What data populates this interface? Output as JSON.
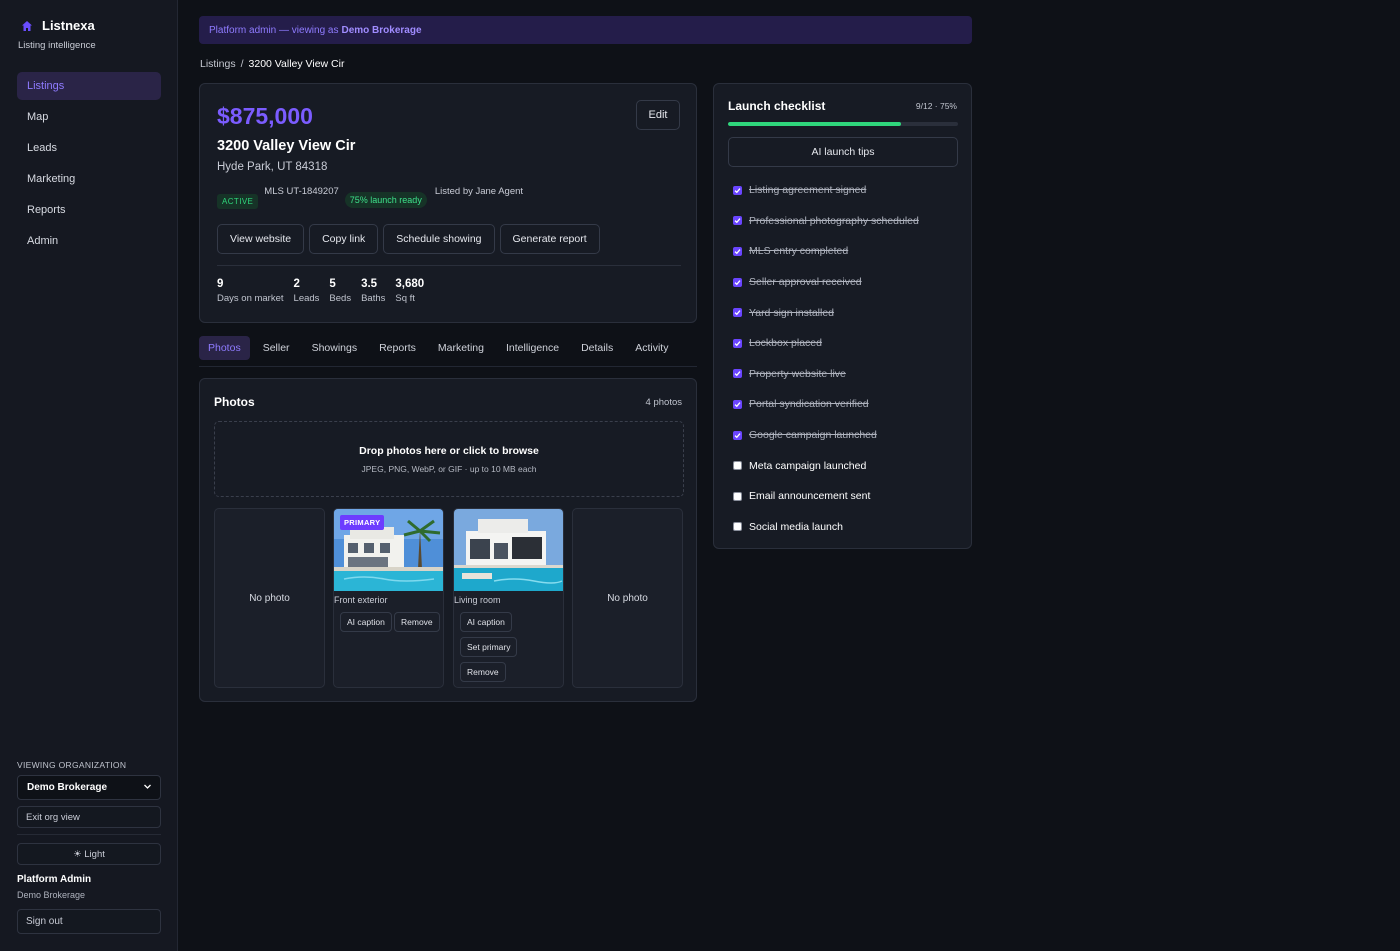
{
  "app": {
    "name": "Listnexa",
    "tagline": "Listing intelligence",
    "nav": [
      "Listings",
      "Map",
      "Leads",
      "Marketing",
      "Reports",
      "Admin"
    ],
    "active_nav": "Listings"
  },
  "sidebar_footer": {
    "org_label": "VIEWING ORGANIZATION",
    "org_selected": "Demo Brokerage",
    "exit_label": "Exit org view",
    "theme_icon": "sun-icon",
    "theme_label": "☀ Light",
    "user_name": "Platform Admin",
    "user_org": "Demo Brokerage",
    "signout_label": "Sign out"
  },
  "banner": {
    "text": "Platform admin — viewing as",
    "org": "Demo Brokerage"
  },
  "breadcrumb": {
    "root": "Listings",
    "separator": "/",
    "current": "3200 Valley View Cir"
  },
  "listing": {
    "price": "$875,000",
    "edit_label": "Edit",
    "address": "3200 Valley View Cir",
    "city_line": "Hyde Park, UT 84318",
    "status": "ACTIVE",
    "mls": "MLS UT-1849207",
    "readiness": "75% launch ready",
    "listed_by": "Listed by Jane Agent",
    "actions": [
      "View website",
      "Copy link",
      "Schedule showing",
      "Generate report"
    ],
    "stats": [
      {
        "value": "9",
        "label": "Days on market"
      },
      {
        "value": "2",
        "label": "Leads"
      },
      {
        "value": "5",
        "label": "Beds"
      },
      {
        "value": "3.5",
        "label": "Baths"
      },
      {
        "value": "3,680",
        "label": "Sq ft"
      }
    ]
  },
  "tabs": [
    "Photos",
    "Seller",
    "Showings",
    "Reports",
    "Marketing",
    "Intelligence",
    "Details",
    "Activity"
  ],
  "active_tab": "Photos",
  "photos": {
    "title": "Photos",
    "count": "4 photos",
    "drop_main": "Drop photos here or click to browse",
    "drop_sub": "JPEG, PNG, WebP, or GIF · up to 10 MB each",
    "tiles": [
      {
        "empty_label": "No photo"
      },
      {
        "badge": "PRIMARY",
        "caption": "Front exterior",
        "buttons": [
          "AI caption",
          "Remove"
        ]
      },
      {
        "caption": "Living room",
        "buttons": [
          "AI caption",
          "Set primary",
          "Remove"
        ]
      },
      {
        "empty_label": "No photo"
      }
    ]
  },
  "checklist": {
    "title": "Launch checklist",
    "progress_text": "9/12 · 75%",
    "progress_fraction": 0.75,
    "tips_label": "AI launch tips",
    "items": [
      {
        "label": "Listing agreement signed",
        "done": true
      },
      {
        "label": "Professional photography scheduled",
        "done": true
      },
      {
        "label": "MLS entry completed",
        "done": true
      },
      {
        "label": "Seller approval received",
        "done": true
      },
      {
        "label": "Yard sign installed",
        "done": true
      },
      {
        "label": "Lockbox placed",
        "done": true
      },
      {
        "label": "Property website live",
        "done": true
      },
      {
        "label": "Portal syndication verified",
        "done": true
      },
      {
        "label": "Google campaign launched",
        "done": true
      },
      {
        "label": "Meta campaign launched",
        "done": false
      },
      {
        "label": "Email announcement sent",
        "done": false
      },
      {
        "label": "Social media launch",
        "done": false
      }
    ]
  },
  "colors": {
    "accent": "#7b5cff",
    "success": "#2fd67c",
    "background": "#0e1117",
    "panel": "#171b24"
  }
}
